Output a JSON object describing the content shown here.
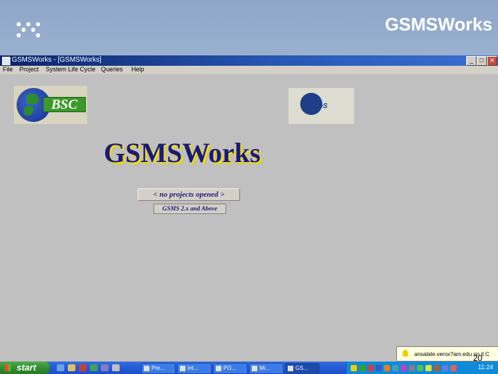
{
  "slide": {
    "title": "GSMSWorks",
    "page_number": "20"
  },
  "window": {
    "title": "GSMSWorks - [GSMSWorks]",
    "minimize": "_",
    "maximize": "□",
    "close": "✕"
  },
  "menu": [
    "File",
    "Project",
    "System Life Cycle",
    "Queries",
    "Help"
  ],
  "logos": {
    "bsc": "BSC",
    "eds": "EDS"
  },
  "main": {
    "app_logo": "GSMSWorks",
    "no_projects": "< no projects opened >",
    "version": "GSMS 2.x and Above"
  },
  "tooltip": {
    "text": "ansalate.verox?am.edu on it C"
  },
  "taskbar": {
    "start": "start",
    "tasks": [
      "Pre...",
      "Int...",
      "PO...",
      "Mi...",
      "GS..."
    ],
    "clock": "11:24"
  },
  "colors": {
    "title_bar": "#0a246a",
    "taskbar": "#245edb",
    "start_button": "#2e8b2e",
    "logo_text": "#1a1a7a",
    "logo_shadow": "#f0e020"
  }
}
